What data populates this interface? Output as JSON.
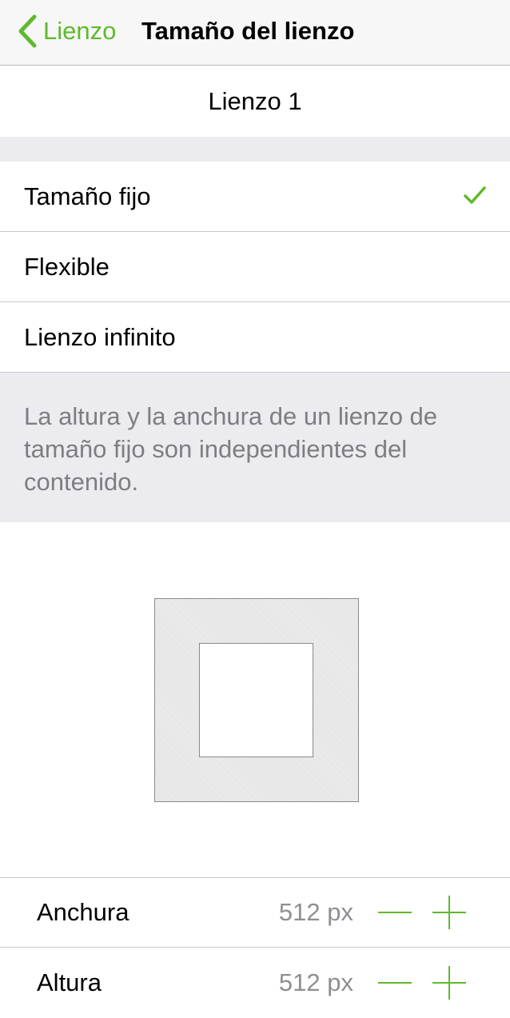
{
  "nav": {
    "back_label": "Lienzo",
    "title": "Tamaño del lienzo"
  },
  "canvas_name": "Lienzo 1",
  "options": [
    {
      "label": "Tamaño fijo",
      "selected": true
    },
    {
      "label": "Flexible",
      "selected": false
    },
    {
      "label": "Lienzo infinito",
      "selected": false
    }
  ],
  "description": "La altura y la anchura de un lienzo de tamaño fijo son independientes del contenido.",
  "dimensions": {
    "width": {
      "label": "Anchura",
      "value": "512 px"
    },
    "height": {
      "label": "Altura",
      "value": "512 px"
    }
  },
  "colors": {
    "accent": "#5fb92d",
    "grouped_background": "#ebebf0",
    "secondary_text": "#8e8e93"
  },
  "icons": {
    "back": "chevron-left-icon",
    "selected": "checkmark-icon",
    "decrement": "minus-icon",
    "increment": "plus-icon"
  }
}
